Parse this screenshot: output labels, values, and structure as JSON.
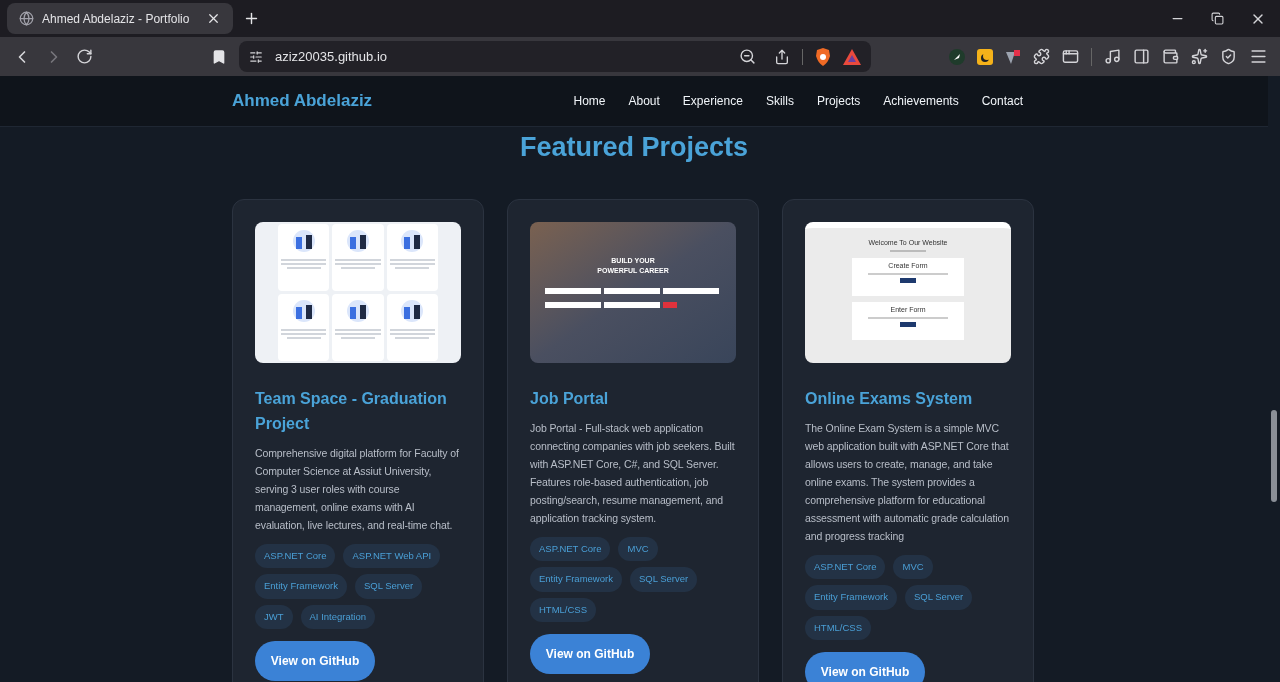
{
  "browser": {
    "tab_title": "Ahmed Abdelaziz - Portfolio",
    "url": "aziz20035.github.io"
  },
  "navbar": {
    "brand": "Ahmed Abdelaziz",
    "links": [
      "Home",
      "About",
      "Experience",
      "Skills",
      "Projects",
      "Achievements",
      "Contact"
    ]
  },
  "section": {
    "title": "Featured Projects"
  },
  "projects": [
    {
      "kind": "team-grid",
      "title": "Team Space - Graduation Project",
      "description": "Comprehensive digital platform for Faculty of Computer Science at Assiut University, serving 3 user roles with course management, online exams with AI evaluation, live lectures, and real-time chat.",
      "tags": [
        "ASP.NET Core",
        "ASP.NET Web API",
        "Entity Framework",
        "SQL Server",
        "JWT",
        "AI Integration"
      ],
      "button": "View on GitHub"
    },
    {
      "kind": "job-portal",
      "preview_texts": [
        "BUILD YOUR",
        "POWERFUL CAREER"
      ],
      "title": "Job Portal",
      "description": "Job Portal - Full-stack web application connecting companies with job seekers. Built with ASP.NET Core, C#, and SQL Server. Features role-based authentication, job posting/search, resume management, and application tracking system.",
      "tags": [
        "ASP.NET Core",
        "MVC",
        "Entity Framework",
        "SQL Server",
        "HTML/CSS"
      ],
      "button": "View on GitHub"
    },
    {
      "kind": "exam-forms",
      "preview_texts": [
        "Welcome To Our Website",
        "Create Form",
        "Enter Form"
      ],
      "title": "Online Exams System",
      "description": "The Online Exam System is a simple MVC web application built with ASP.NET Core that allows users to create, manage, and take online exams. The system provides a comprehensive platform for educational assessment with automatic grade calculation and progress tracking",
      "tags": [
        "ASP.NET Core",
        "MVC",
        "Entity Framework",
        "SQL Server",
        "HTML/CSS"
      ],
      "button": "View on GitHub"
    }
  ]
}
